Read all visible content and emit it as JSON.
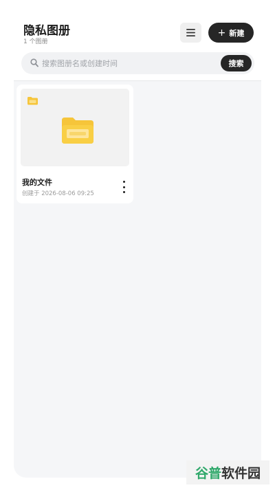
{
  "header": {
    "title": "隐私图册",
    "subtitle": "1 个图册",
    "menu_icon": "hamburger-menu-icon",
    "new_button": {
      "icon": "plus",
      "label": "新建"
    }
  },
  "search": {
    "placeholder": "搜索图册名或创建时间",
    "value": "",
    "button_label": "搜索",
    "icon": "search-icon"
  },
  "albums": [
    {
      "name": "我的文件",
      "created": "创建于 2026-08-06 09:25",
      "badge_icon": "folder-icon",
      "thumbnail_icon": "folder-icon",
      "menu_icon": "more-vertical-icon"
    }
  ],
  "watermark": {
    "part_a": "谷普",
    "part_b": "软件园"
  },
  "colors": {
    "accent_dark": "#262626",
    "folder_yellow": "#f6c53a",
    "watermark_green": "#2fa86a"
  }
}
